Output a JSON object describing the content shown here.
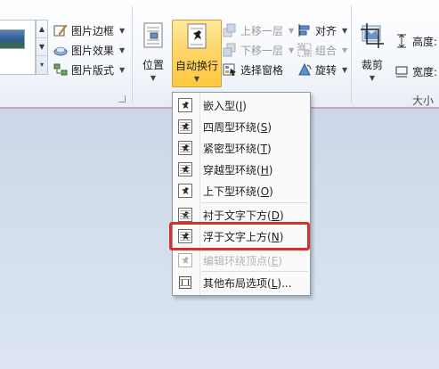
{
  "ribbon": {
    "picture_border": "图片边框",
    "picture_effects": "图片效果",
    "picture_layout": "图片版式",
    "position": "位置",
    "auto_wrap": "自动换行",
    "bring_forward": "上移一层",
    "send_backward": "下移一层",
    "selection_pane": "选择窗格",
    "align": "对齐",
    "group": "组合",
    "rotate": "旋转",
    "crop": "裁剪",
    "height_label": "高度:",
    "width_label": "宽度:",
    "size_group": "大小"
  },
  "wrap_menu": {
    "items": [
      {
        "text": "嵌入型",
        "key": "I"
      },
      {
        "text": "四周型环绕",
        "key": "S"
      },
      {
        "text": "紧密型环绕",
        "key": "T"
      },
      {
        "text": "穿越型环绕",
        "key": "H"
      },
      {
        "text": "上下型环绕",
        "key": "O"
      },
      {
        "text": "衬于文字下方",
        "key": "D"
      },
      {
        "text": "浮于文字上方",
        "key": "N"
      },
      {
        "text": "编辑环绕顶点",
        "key": "E"
      },
      {
        "text": "其他布局选项",
        "key": "L",
        "suffix": "..."
      }
    ]
  },
  "colors": {
    "highlight": "#d8312a",
    "active_button": "#ffd66b",
    "ribbon_border": "#d39fbf"
  }
}
